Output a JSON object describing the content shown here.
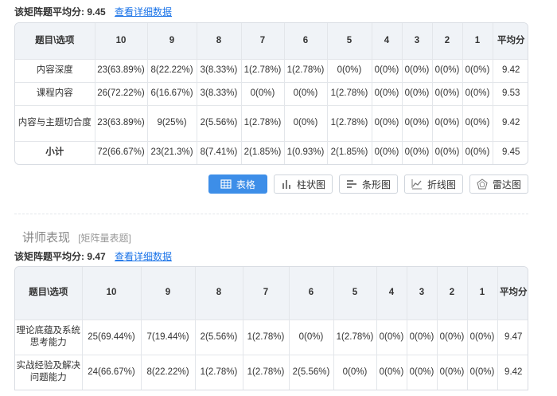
{
  "matrix1": {
    "avg_label": "该矩阵题平均分:",
    "avg_value": "9.45",
    "detail_link": "查看详细数据",
    "headers": [
      "题目\\选项",
      "10",
      "9",
      "8",
      "7",
      "6",
      "5",
      "4",
      "3",
      "2",
      "1",
      "平均分"
    ],
    "rows": [
      {
        "label": "内容深度",
        "cells": [
          "23(63.89%)",
          "8(22.22%)",
          "3(8.33%)",
          "1(2.78%)",
          "1(2.78%)",
          "0(0%)",
          "0(0%)",
          "0(0%)",
          "0(0%)",
          "0(0%)",
          "9.42"
        ]
      },
      {
        "label": "课程内容",
        "cells": [
          "26(72.22%)",
          "6(16.67%)",
          "3(8.33%)",
          "0(0%)",
          "0(0%)",
          "1(2.78%)",
          "0(0%)",
          "0(0%)",
          "0(0%)",
          "0(0%)",
          "9.53"
        ]
      },
      {
        "label": "内容与主题切合度",
        "cells": [
          "23(63.89%)",
          "9(25%)",
          "2(5.56%)",
          "1(2.78%)",
          "0(0%)",
          "1(2.78%)",
          "0(0%)",
          "0(0%)",
          "0(0%)",
          "0(0%)",
          "9.42"
        ]
      },
      {
        "label": "小计",
        "cells": [
          "72(66.67%)",
          "23(21.3%)",
          "8(7.41%)",
          "2(1.85%)",
          "1(0.93%)",
          "2(1.85%)",
          "0(0%)",
          "0(0%)",
          "0(0%)",
          "0(0%)",
          "9.45"
        ]
      }
    ]
  },
  "view_buttons": [
    {
      "label": "表格",
      "icon": "table-icon",
      "active": true
    },
    {
      "label": "柱状图",
      "icon": "bar-chart-icon",
      "active": false
    },
    {
      "label": "条形图",
      "icon": "horizontal-bar-icon",
      "active": false
    },
    {
      "label": "折线图",
      "icon": "line-chart-icon",
      "active": false
    },
    {
      "label": "雷达图",
      "icon": "radar-chart-icon",
      "active": false
    }
  ],
  "section2": {
    "title": "讲师表现",
    "subtitle": "[矩阵量表题]"
  },
  "matrix2": {
    "avg_label": "该矩阵题平均分:",
    "avg_value": "9.47",
    "detail_link": "查看详细数据",
    "headers": [
      "题目\\选项",
      "10",
      "9",
      "8",
      "7",
      "6",
      "5",
      "4",
      "3",
      "2",
      "1",
      "平均分"
    ],
    "rows": [
      {
        "label": "理论底蕴及系统思考能力",
        "cells": [
          "25(69.44%)",
          "7(19.44%)",
          "2(5.56%)",
          "1(2.78%)",
          "0(0%)",
          "1(2.78%)",
          "0(0%)",
          "0(0%)",
          "0(0%)",
          "0(0%)",
          "9.47"
        ]
      },
      {
        "label": "实战经验及解决问题能力",
        "cells": [
          "24(66.67%)",
          "8(22.22%)",
          "1(2.78%)",
          "1(2.78%)",
          "2(5.56%)",
          "0(0%)",
          "0(0%)",
          "0(0%)",
          "0(0%)",
          "0(0%)",
          "9.42"
        ]
      }
    ]
  }
}
